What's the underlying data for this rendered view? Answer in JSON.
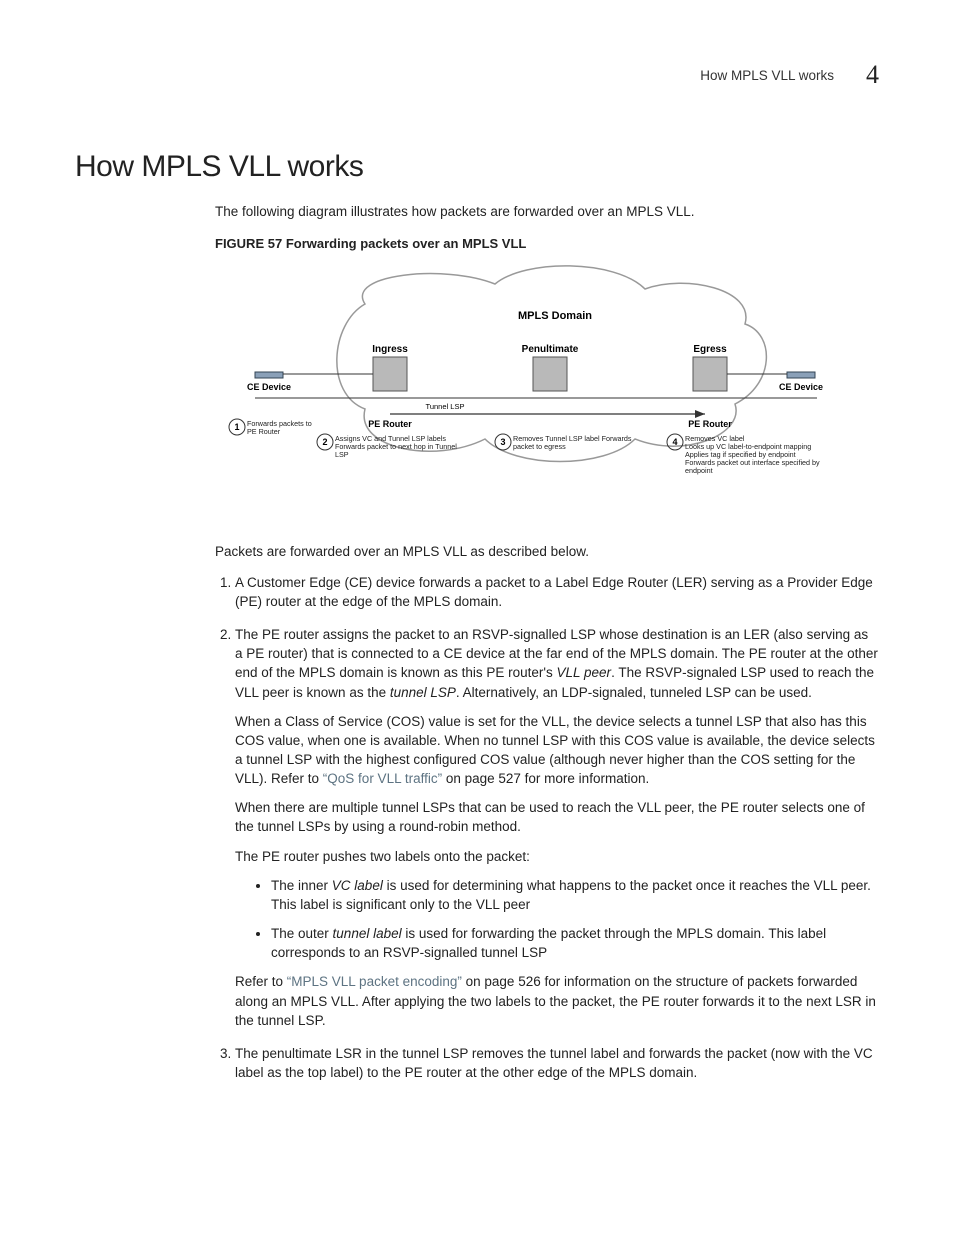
{
  "header": {
    "running_title": "How MPLS VLL works",
    "chapter_num": "4"
  },
  "title": "How MPLS VLL works",
  "intro": "The following diagram illustrates how packets are forwarded over an MPLS VLL.",
  "figure": {
    "label": "FIGURE 57",
    "caption": "Forwarding packets over an MPLS VLL",
    "labels": {
      "mpls_domain": "MPLS Domain",
      "ingress": "Ingress",
      "penultimate": "Penultimate",
      "egress": "Egress",
      "ce_left": "CE Device",
      "ce_right": "CE Device",
      "pe_left": "PE Router",
      "pe_right": "PE Router",
      "tunnel_lsp": "Tunnel LSP",
      "step1": "Forwards packets to PE Router",
      "step2": "Assigns VC and Tunnel LSP labels Forwards packet to next hop in Tunnel LSP",
      "step3": "Removes Tunnel LSP label Forwards packet to egress",
      "step4": "Removes VC label\nLooks up VC label-to-endpoint mapping\nApplies tag if specified by endpoint\nForwards packet out interface specified by endpoint"
    }
  },
  "lead": "Packets are forwarded over an MPLS VLL as described below.",
  "steps": {
    "s1": "A Customer Edge (CE) device forwards a packet to a Label Edge Router (LER) serving as a Provider Edge (PE) router at the edge of the MPLS domain.",
    "s2_a": "The PE router assigns the packet to an RSVP-signalled LSP whose destination is an LER (also serving as a PE router) that is connected to a CE device at the far end of the MPLS domain. The PE router at the other end of the MPLS domain is known as this PE router's ",
    "s2_vll_peer": "VLL peer",
    "s2_b": ". The RSVP-signaled LSP used to reach the VLL peer is known as the ",
    "s2_tunnel_lsp": "tunnel LSP",
    "s2_c": ". Alternatively, an LDP-signaled, tunneled LSP can be used.",
    "s2_cos_a": "When a Class of Service (COS) value is set for the VLL, the device selects a tunnel LSP that also has this COS value, when one is available. When no tunnel LSP with this COS value is available, the device selects a tunnel LSP with the highest configured COS value (although never higher than the COS setting for the VLL). Refer to ",
    "s2_cos_link": "“QoS for VLL traffic”",
    "s2_cos_b": " on page 527 for more information.",
    "s2_rr": "When there are multiple tunnel LSPs that can be used to reach the VLL peer, the PE router selects one of the tunnel LSPs by using a round-robin method.",
    "s2_push": "The PE router pushes two labels onto the packet:",
    "bullet1_a": "The inner ",
    "bullet1_i": "VC label",
    "bullet1_b": " is used for determining what happens to the packet once it reaches the VLL peer. This label is significant only to the VLL peer",
    "bullet2_a": "The outer ",
    "bullet2_i": "tunnel label",
    "bullet2_b": " is used for forwarding the packet through the MPLS domain. This label corresponds to an RSVP-signalled tunnel LSP",
    "s2_refer_a": "Refer to ",
    "s2_refer_link": "“MPLS VLL packet encoding”",
    "s2_refer_b": " on page 526 for information on the structure of packets forwarded along an MPLS VLL. After applying the two labels to the packet, the PE router forwards it to the next LSR in the tunnel LSP.",
    "s3": "The penultimate LSR in the tunnel LSP removes the tunnel label and forwards the packet (now with the VC label as the top label) to the PE router at the other edge of the MPLS domain."
  }
}
